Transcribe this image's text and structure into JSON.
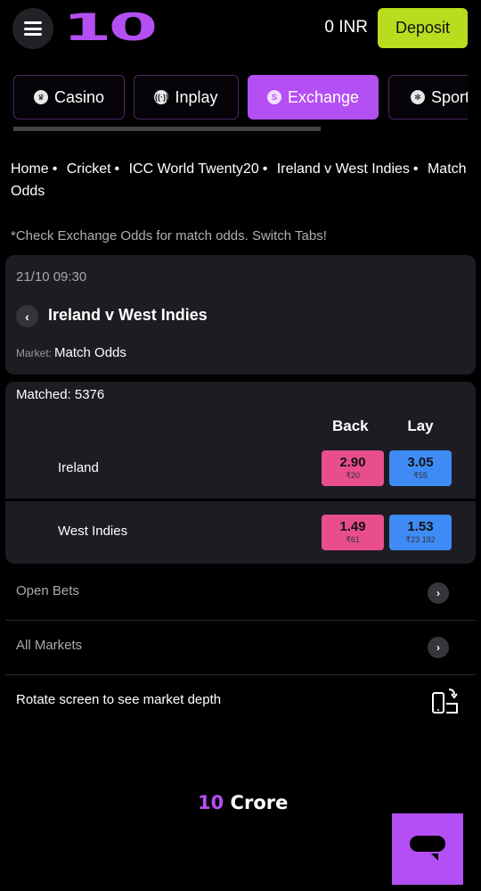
{
  "header": {
    "logo": "10",
    "balance": "0 INR",
    "deposit_label": "Deposit"
  },
  "tabs": [
    {
      "label": "Casino",
      "icon": "crown-icon",
      "active": false
    },
    {
      "label": "Inplay",
      "icon": "live-signal-icon",
      "active": false
    },
    {
      "label": "Exchange",
      "icon": "exchange-icon",
      "active": true
    },
    {
      "label": "Sport",
      "icon": "ball-icon",
      "active": false
    }
  ],
  "breadcrumb": [
    "Home",
    "Cricket",
    "ICC World Twenty20",
    "Ireland v West Indies",
    "Match Odds"
  ],
  "note": "*Check Exchange Odds for match odds. Switch Tabs!",
  "event": {
    "datetime": "21/10 09:30",
    "title": "Ireland v West Indies",
    "market_label": "Market:",
    "market_value": "Match Odds"
  },
  "odds": {
    "matched": "Matched: 5376",
    "back_header": "Back",
    "lay_header": "Lay",
    "runners": [
      {
        "name": "Ireland",
        "back_price": "2.90",
        "back_size": "₹20",
        "lay_price": "3.05",
        "lay_size": "₹55"
      },
      {
        "name": "West Indies",
        "back_price": "1.49",
        "back_size": "₹61",
        "lay_price": "1.53",
        "lay_size": "₹23 192"
      }
    ]
  },
  "links": {
    "open_bets": "Open Bets",
    "all_markets": "All Markets",
    "rotate": "Rotate screen to see market depth"
  },
  "footer": {
    "logo_accent": "10",
    "logo_text": "Crore"
  },
  "colors": {
    "brand": "#b44ff3",
    "deposit": "#b9dc1f",
    "back": "#e84e8e",
    "lay": "#3f8bf5"
  }
}
